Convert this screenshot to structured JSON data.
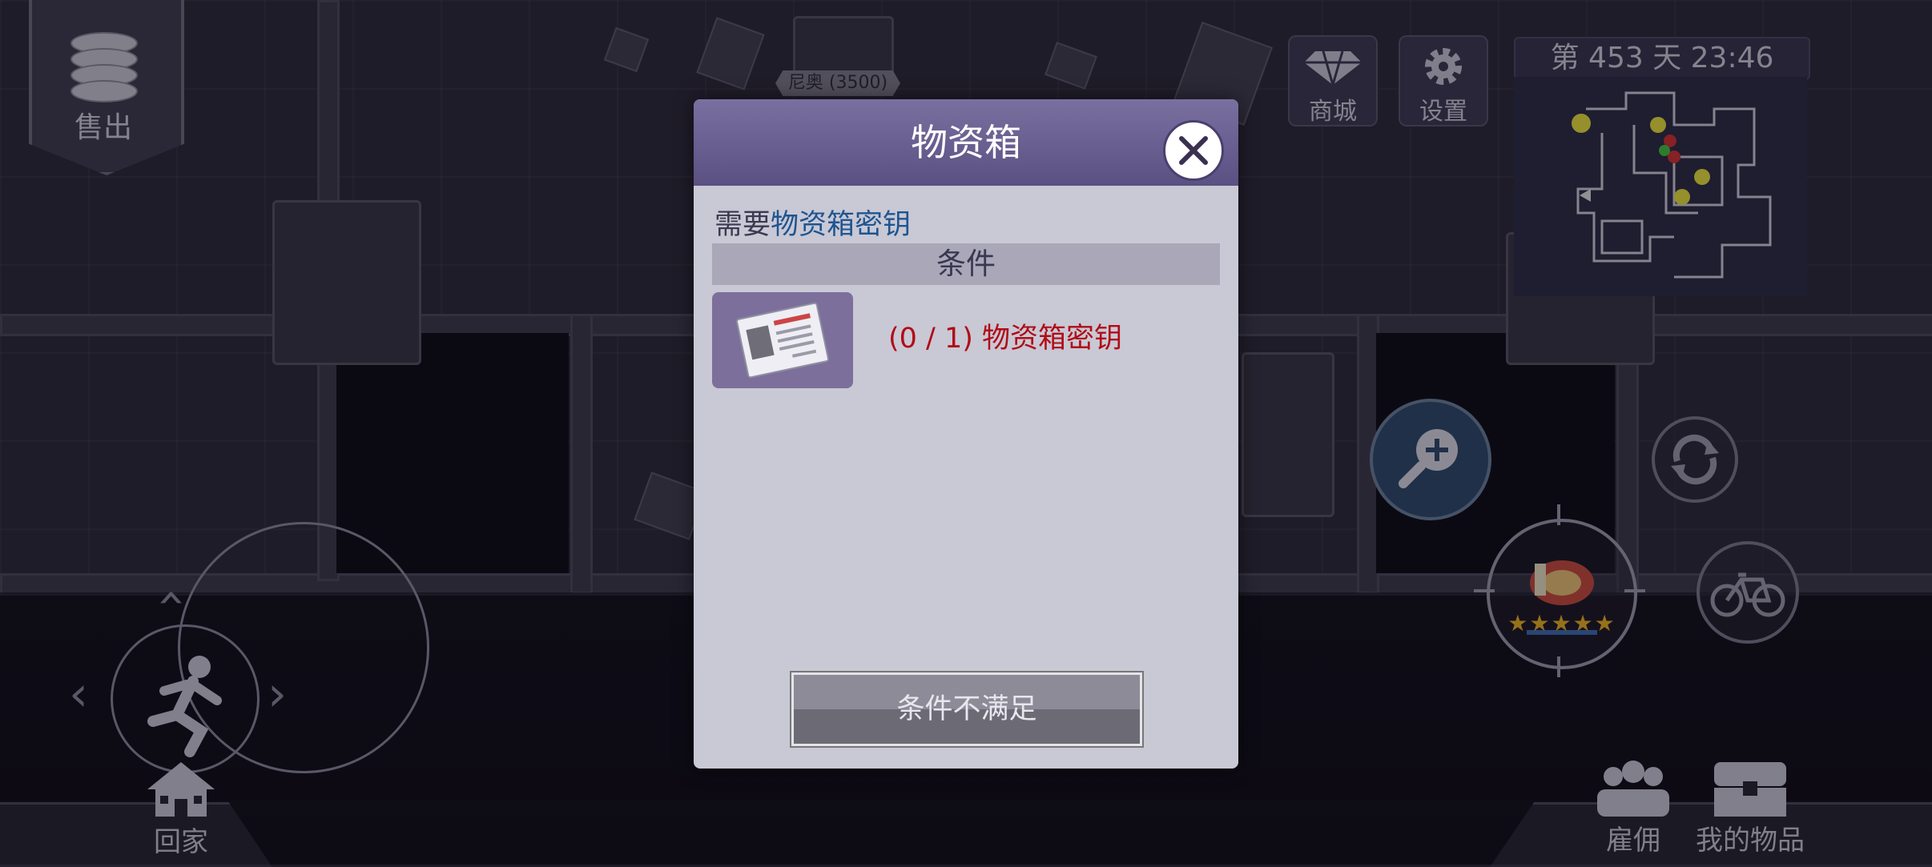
{
  "hud": {
    "sell_label": "售出",
    "npc_tag": "尼奥 (3500)",
    "shop_label": "商城",
    "settings_label": "设置",
    "day_clock": "第 453 天  23:46",
    "home_label": "回家",
    "hire_label": "雇佣",
    "my_items_label": "我的物品",
    "weapon_stars": 5,
    "shop_icon": "diamond-icon",
    "settings_icon": "gear-icon",
    "zoom_icon": "magnify-plus-icon",
    "refresh_icon": "refresh-icon",
    "bike_icon": "bicycle-icon",
    "run_icon": "running-man-icon",
    "home_icon": "house-icon",
    "hire_icon": "people-icon",
    "items_icon": "chest-icon"
  },
  "dialog": {
    "title": "物资箱",
    "requirement_prefix": "需要",
    "requirement_item": "物资箱密钥",
    "conditions_header": "条件",
    "condition_text": "(0 / 1) 物资箱密钥",
    "button_label": "条件不满足",
    "close_icon": "close-icon",
    "condition_icon": "id-card-icon"
  },
  "colors": {
    "dialog_header": "#6a5f92",
    "requirement_item": "#1f5590",
    "condition_unmet": "#b00d16"
  }
}
